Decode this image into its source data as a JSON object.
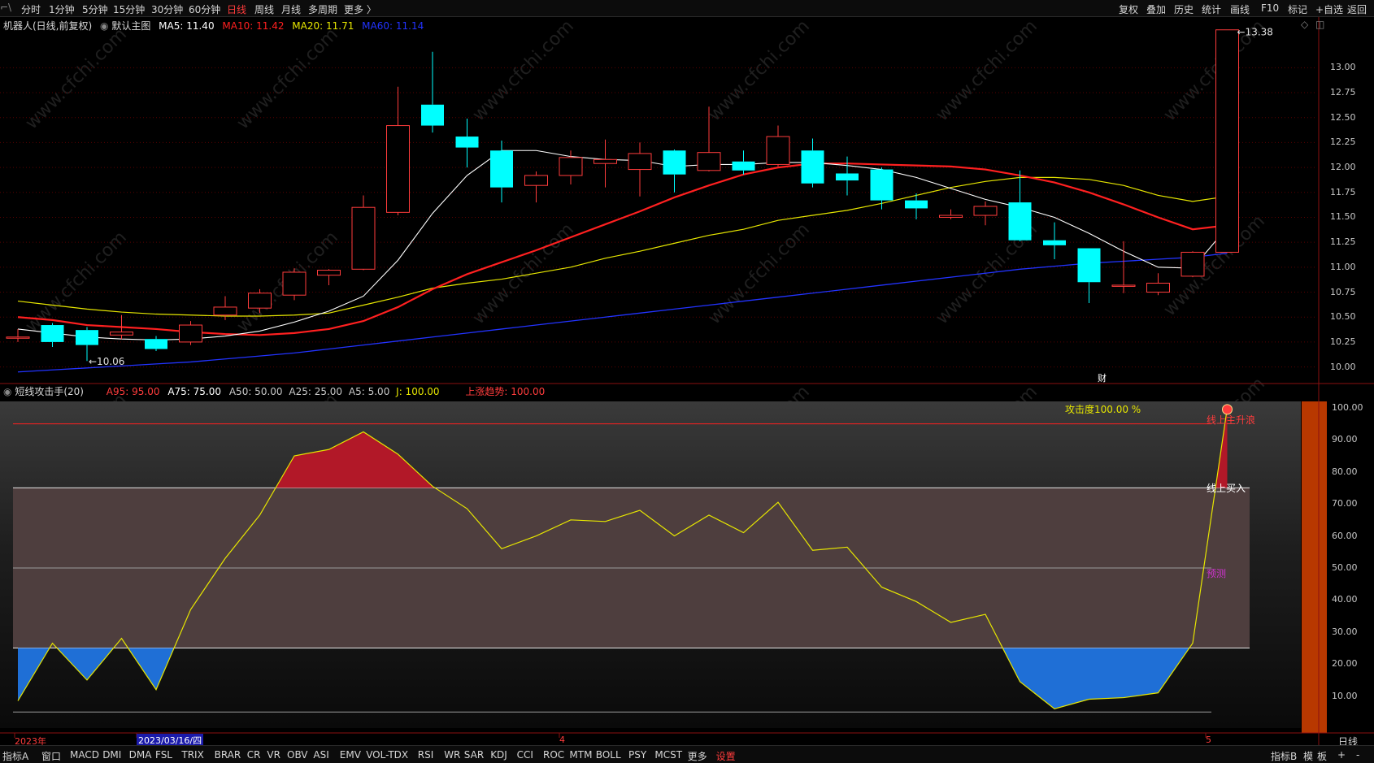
{
  "toolbar_left": [
    {
      "label": "分时",
      "active": false
    },
    {
      "label": "1分钟",
      "active": false
    },
    {
      "label": "5分钟",
      "active": false
    },
    {
      "label": "15分钟",
      "active": false
    },
    {
      "label": "30分钟",
      "active": false
    },
    {
      "label": "60分钟",
      "active": false
    },
    {
      "label": "日线",
      "active": true
    },
    {
      "label": "周线",
      "active": false
    },
    {
      "label": "月线",
      "active": false
    },
    {
      "label": "多周期",
      "active": false
    },
    {
      "label": "更多 〉",
      "active": false
    }
  ],
  "toolbar_right": [
    "复权",
    "叠加",
    "历史",
    "统计",
    "画线",
    "F10",
    "标记",
    "+自选",
    "返回"
  ],
  "main_header": {
    "stock": "机器人(日线,前复权)",
    "template": "默认主图",
    "ma5": {
      "label": "MA5: 11.40",
      "color": "#ffffff"
    },
    "ma10": {
      "label": "MA10: 11.42",
      "color": "#ff2020"
    },
    "ma20": {
      "label": "MA20: 11.71",
      "color": "#e6e600"
    },
    "ma60": {
      "label": "MA60: 11.14",
      "color": "#2233ff"
    }
  },
  "price_annotations": {
    "low": "10.06",
    "high": "13.38",
    "finance_marker": "财"
  },
  "price_axis": {
    "ticks": [
      "13.00",
      "12.75",
      "12.50",
      "12.25",
      "12.00",
      "11.75",
      "11.50",
      "11.25",
      "11.00",
      "10.75",
      "10.50",
      "10.25",
      "10.00"
    ]
  },
  "ind_header": {
    "name": "短线攻击手(20)",
    "a95": "A95: 95.00",
    "a75": "A75: 75.00",
    "a50": "A50: 50.00",
    "a25": "A25: 25.00",
    "a5": "A5: 5.00",
    "j": "J: 100.00",
    "trend": "上涨趋势: 100.00"
  },
  "ind_annotations": {
    "attack": "攻击度100.00 %",
    "wave": "线上主升浪",
    "buy": "线上买入",
    "predict": "预测"
  },
  "ind_axis": {
    "ticks": [
      "100.00",
      "90.00",
      "80.00",
      "70.00",
      "60.00",
      "50.00",
      "40.00",
      "30.00",
      "20.00",
      "10.00"
    ]
  },
  "date_axis": {
    "year": "2023年",
    "cursor_date": "2023/03/16/四",
    "month4": "4",
    "month5": "5",
    "period": "日线"
  },
  "bottom_tabs": [
    "指标A",
    "窗口",
    "MACD",
    "DMI",
    "DMA",
    "FSL",
    "TRIX",
    "BRAR",
    "CR",
    "VR",
    "OBV",
    "ASI",
    "EMV",
    "VOL-TDX",
    "RSI",
    "WR",
    "SAR",
    "KDJ",
    "CCI",
    "ROC",
    "MTM",
    "BOLL",
    "PSY",
    "MCST",
    "更多",
    "设置"
  ],
  "bottom_right": [
    "指标B",
    "模",
    "板",
    "+",
    "-"
  ],
  "watermark": "www.cfchi.com",
  "chart_data": {
    "type": "candlestick",
    "ylim": [
      9.85,
      13.5
    ],
    "candles": [
      {
        "o": 10.3,
        "c": 10.3,
        "h": 10.38,
        "l": 10.25
      },
      {
        "o": 10.42,
        "c": 10.25,
        "h": 10.44,
        "l": 10.2
      },
      {
        "o": 10.37,
        "c": 10.22,
        "h": 10.4,
        "l": 10.06
      },
      {
        "o": 10.32,
        "c": 10.35,
        "h": 10.52,
        "l": 10.28
      },
      {
        "o": 10.28,
        "c": 10.18,
        "h": 10.31,
        "l": 10.16
      },
      {
        "o": 10.25,
        "c": 10.42,
        "h": 10.46,
        "l": 10.22
      },
      {
        "o": 10.52,
        "c": 10.6,
        "h": 10.71,
        "l": 10.47
      },
      {
        "o": 10.59,
        "c": 10.74,
        "h": 10.78,
        "l": 10.54
      },
      {
        "o": 10.72,
        "c": 10.95,
        "h": 10.99,
        "l": 10.67
      },
      {
        "o": 10.92,
        "c": 10.97,
        "h": 10.98,
        "l": 10.82
      },
      {
        "o": 10.98,
        "c": 11.6,
        "h": 11.72,
        "l": 10.97
      },
      {
        "o": 11.55,
        "c": 12.42,
        "h": 12.81,
        "l": 11.52
      },
      {
        "o": 12.63,
        "c": 12.42,
        "h": 13.16,
        "l": 12.35
      },
      {
        "o": 12.31,
        "c": 12.2,
        "h": 12.49,
        "l": 12.0
      },
      {
        "o": 12.17,
        "c": 11.8,
        "h": 12.27,
        "l": 11.65
      },
      {
        "o": 11.82,
        "c": 11.92,
        "h": 11.96,
        "l": 11.65
      },
      {
        "o": 11.92,
        "c": 12.1,
        "h": 12.17,
        "l": 11.83
      },
      {
        "o": 12.04,
        "c": 12.08,
        "h": 12.28,
        "l": 11.8
      },
      {
        "o": 11.98,
        "c": 12.14,
        "h": 12.25,
        "l": 11.71
      },
      {
        "o": 12.17,
        "c": 11.93,
        "h": 12.18,
        "l": 11.75
      },
      {
        "o": 11.97,
        "c": 12.15,
        "h": 12.61,
        "l": 11.96
      },
      {
        "o": 12.06,
        "c": 11.97,
        "h": 12.17,
        "l": 11.93
      },
      {
        "o": 12.03,
        "c": 12.31,
        "h": 12.42,
        "l": 12.01
      },
      {
        "o": 12.17,
        "c": 11.84,
        "h": 12.29,
        "l": 11.8
      },
      {
        "o": 11.94,
        "c": 11.87,
        "h": 12.11,
        "l": 11.72
      },
      {
        "o": 11.98,
        "c": 11.67,
        "h": 12.0,
        "l": 11.58
      },
      {
        "o": 11.67,
        "c": 11.59,
        "h": 11.74,
        "l": 11.48
      },
      {
        "o": 11.5,
        "c": 11.52,
        "h": 11.58,
        "l": 11.48
      },
      {
        "o": 11.52,
        "c": 11.61,
        "h": 11.66,
        "l": 11.42
      },
      {
        "o": 11.65,
        "c": 11.27,
        "h": 11.97,
        "l": 11.26
      },
      {
        "o": 11.27,
        "c": 11.22,
        "h": 11.45,
        "l": 11.08
      },
      {
        "o": 11.19,
        "c": 10.85,
        "h": 11.19,
        "l": 10.64
      },
      {
        "o": 10.82,
        "c": 10.82,
        "h": 11.26,
        "l": 10.74
      },
      {
        "o": 10.75,
        "c": 10.84,
        "h": 10.94,
        "l": 10.72
      },
      {
        "o": 10.91,
        "c": 11.15,
        "h": 11.16,
        "l": 10.9
      },
      {
        "o": 11.15,
        "c": 13.38,
        "h": 13.38,
        "l": 11.15
      }
    ],
    "ma5": [
      10.38,
      10.34,
      10.3,
      10.28,
      10.27,
      10.28,
      10.31,
      10.36,
      10.45,
      10.56,
      10.71,
      11.07,
      11.54,
      11.92,
      12.17,
      12.17,
      12.11,
      12.08,
      12.07,
      12.01,
      12.03,
      12.03,
      12.05,
      12.05,
      12.02,
      11.98,
      11.9,
      11.79,
      11.68,
      11.6,
      11.5,
      11.34,
      11.16,
      11.0,
      10.99,
      11.4
    ],
    "ma10": [
      10.5,
      10.47,
      10.42,
      10.4,
      10.38,
      10.35,
      10.33,
      10.32,
      10.34,
      10.38,
      10.46,
      10.6,
      10.78,
      10.93,
      11.05,
      11.17,
      11.3,
      11.43,
      11.56,
      11.7,
      11.82,
      11.93,
      12.0,
      12.04,
      12.04,
      12.03,
      12.02,
      12.01,
      11.98,
      11.92,
      11.85,
      11.75,
      11.63,
      11.5,
      11.38,
      11.42
    ],
    "ma20": [
      10.66,
      10.62,
      10.58,
      10.55,
      10.53,
      10.52,
      10.51,
      10.51,
      10.52,
      10.54,
      10.62,
      10.7,
      10.79,
      10.84,
      10.88,
      10.94,
      11.0,
      11.09,
      11.16,
      11.24,
      11.32,
      11.38,
      11.47,
      11.52,
      11.57,
      11.64,
      11.72,
      11.8,
      11.86,
      11.9,
      11.9,
      11.88,
      11.82,
      11.72,
      11.66,
      11.71
    ],
    "ma60": [
      9.95,
      9.97,
      9.99,
      10.01,
      10.03,
      10.05,
      10.08,
      10.11,
      10.14,
      10.18,
      10.22,
      10.26,
      10.3,
      10.34,
      10.38,
      10.42,
      10.46,
      10.5,
      10.54,
      10.58,
      10.62,
      10.66,
      10.7,
      10.74,
      10.78,
      10.82,
      10.86,
      10.9,
      10.94,
      10.98,
      11.01,
      11.04,
      11.06,
      11.08,
      11.1,
      11.14
    ],
    "indicator": {
      "name": "短线攻击手(20)",
      "ylim": [
        0,
        102
      ],
      "levels": [
        95,
        75,
        50,
        25,
        5
      ],
      "j": [
        8.5,
        26.5,
        15,
        28,
        12,
        37,
        53,
        66.5,
        85,
        87,
        92.5,
        85.5,
        75.5,
        68.5,
        56,
        60,
        65,
        64.5,
        68,
        60,
        66.5,
        61,
        70.5,
        55.5,
        56.5,
        44,
        39.5,
        33,
        35.5,
        14.5,
        6,
        9,
        9.5,
        11,
        26.5,
        100
      ]
    }
  }
}
